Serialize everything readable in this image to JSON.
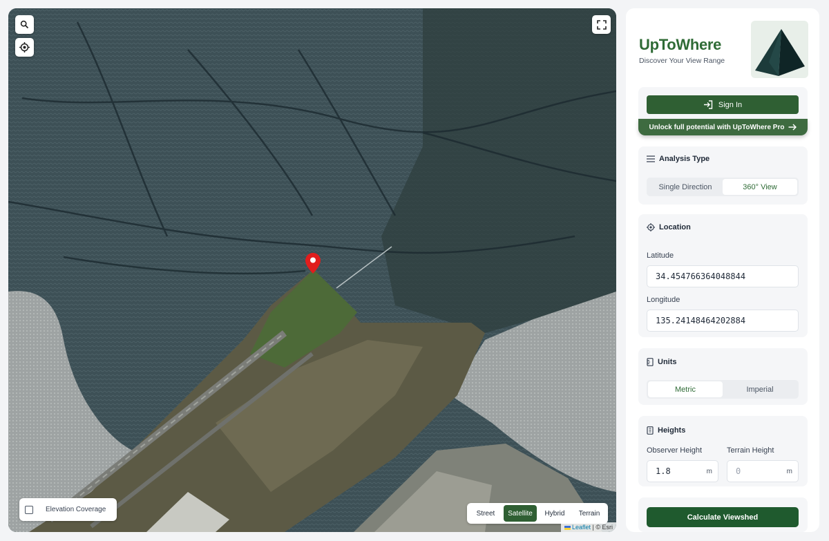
{
  "map": {
    "search_icon": "search-icon",
    "locate_icon": "crosshair-icon",
    "fullscreen_icon": "expand-icon",
    "elevation_label": "Elevation Coverage",
    "layers": [
      {
        "label": "Street",
        "active": false
      },
      {
        "label": "Satellite",
        "active": true
      },
      {
        "label": "Hybrid",
        "active": false
      },
      {
        "label": "Terrain",
        "active": false
      }
    ],
    "attribution_link": "Leaflet",
    "attribution_rest": "| © Esri"
  },
  "sidebar": {
    "app_name": "UpToWhere",
    "tagline": "Discover Your View Range",
    "sign_in": "Sign In",
    "pro_banner": "Unlock full potential with UpToWhere Pro",
    "analysis": {
      "title": "Analysis Type",
      "options": [
        "Single Direction",
        "360° View"
      ],
      "selected": "360° View"
    },
    "location": {
      "title": "Location",
      "latitude_label": "Latitude",
      "latitude_value": "34.454766364048844",
      "longitude_label": "Longitude",
      "longitude_value": "135.24148464202884"
    },
    "units": {
      "title": "Units",
      "options": [
        "Metric",
        "Imperial"
      ],
      "selected": "Metric"
    },
    "heights": {
      "title": "Heights",
      "observer_label": "Observer Height",
      "observer_value": "1.8",
      "observer_unit": "m",
      "terrain_label": "Terrain Height",
      "terrain_value": "0",
      "terrain_unit": "m"
    },
    "calculate": "Calculate Viewshed"
  },
  "colors": {
    "accent": "#2f5f33",
    "brand_text": "#2f6b36",
    "marker": "#e11d1d"
  }
}
